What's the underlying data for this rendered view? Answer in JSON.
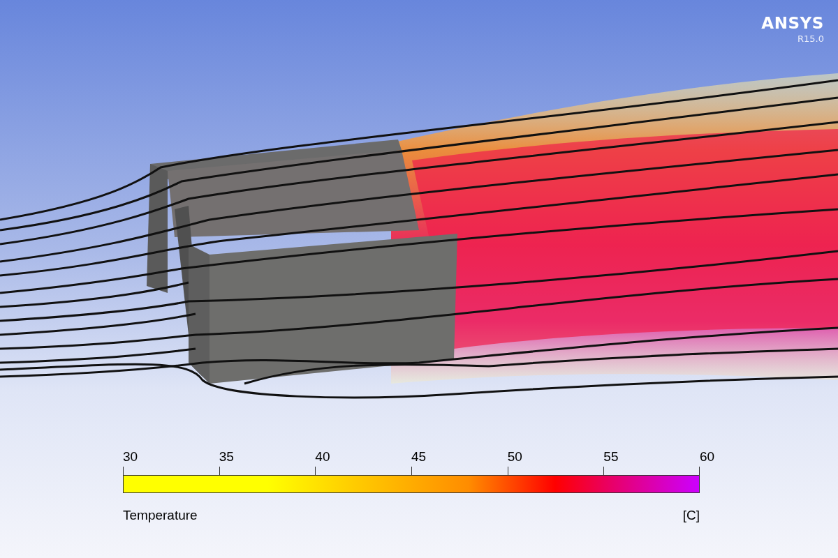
{
  "logo": {
    "name": "ANSYS",
    "version": "R15.0"
  },
  "legend": {
    "ticks": [
      "30",
      "35",
      "40",
      "45",
      "50",
      "55",
      "60"
    ],
    "variable": "Temperature",
    "unit": "[C]"
  }
}
